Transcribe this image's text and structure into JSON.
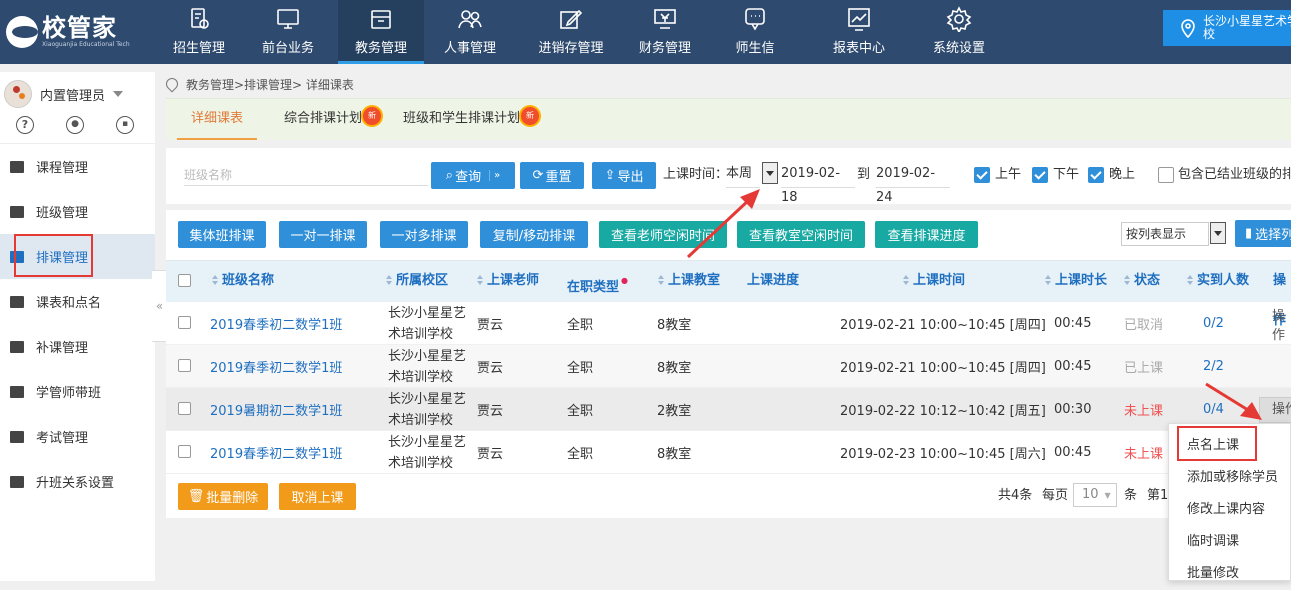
{
  "app": {
    "logo_text": "校管家",
    "logo_sub": "Xiaoguanjia Educational Tech"
  },
  "nav": [
    {
      "label": "招生管理",
      "icon": "enroll-icon"
    },
    {
      "label": "前台业务",
      "icon": "monitor-icon"
    },
    {
      "label": "教务管理",
      "icon": "folder-icon"
    },
    {
      "label": "人事管理",
      "icon": "people-icon"
    },
    {
      "label": "进销存管理",
      "icon": "edit-icon"
    },
    {
      "label": "财务管理",
      "icon": "finance-icon"
    },
    {
      "label": "师生信",
      "icon": "chat-icon"
    },
    {
      "label": "报表中心",
      "icon": "chart-icon"
    },
    {
      "label": "系统设置",
      "icon": "gear-icon"
    }
  ],
  "school": {
    "name": "长沙小星星艺术学校"
  },
  "user": {
    "name": "内置管理员",
    "icons": [
      "?",
      "🔔",
      "💬"
    ]
  },
  "sidebar": [
    {
      "label": "课程管理"
    },
    {
      "label": "班级管理"
    },
    {
      "label": "排课管理"
    },
    {
      "label": "课表和点名"
    },
    {
      "label": "补课管理"
    },
    {
      "label": "学管师带班"
    },
    {
      "label": "考试管理"
    },
    {
      "label": "升班关系设置"
    }
  ],
  "collapse_glyph": "«",
  "breadcrumb": "教务管理>排课管理> 详细课表",
  "tabs": [
    {
      "label": "详细课表"
    },
    {
      "label": "综合排课计划",
      "badge": "新"
    },
    {
      "label": "班级和学生排课计划",
      "badge": "新"
    }
  ],
  "filter": {
    "class_placeholder": "班级名称",
    "query": "查询",
    "reset": "重置",
    "export": "导出",
    "time_label": "上课时间：",
    "period": "本周",
    "date_from": "2019-02-18",
    "to": "到",
    "date_to": "2019-02-24",
    "am": "上午",
    "pm": "下午",
    "eve": "晚上",
    "graduated": "包含已结业班级的排"
  },
  "actions": [
    "集体班排课",
    "一对一排课",
    "一对多排课",
    "复制/移动排课",
    "查看老师空闲时间",
    "查看教室空闲时间",
    "查看排课进度"
  ],
  "display_mode": "按列表显示",
  "select_btn": "选择列",
  "table": {
    "headers": [
      "班级名称",
      "所属校区",
      "上课老师",
      "在职类型",
      "上课教室",
      "上课进度",
      "上课时间",
      "上课时长",
      "状态",
      "实到人数",
      "操作"
    ],
    "rows": [
      {
        "class": "2019春季初二数学1班",
        "campus": "长沙小星星艺术培训学校",
        "teacher": "贾云",
        "type": "全职",
        "room": "8教室",
        "time": "2019-02-21 10:00~10:45 [周四]",
        "dur": "00:45",
        "status": "已取消",
        "count": "0/2",
        "op": "操作"
      },
      {
        "class": "2019春季初二数学1班",
        "campus": "长沙小星星艺术培训学校",
        "teacher": "贾云",
        "type": "全职",
        "room": "8教室",
        "time": "2019-02-21 10:00~10:45 [周四]",
        "dur": "00:45",
        "status": "已上课",
        "count": "2/2",
        "op": ""
      },
      {
        "class": "2019暑期初二数学1班",
        "campus": "长沙小星星艺术培训学校",
        "teacher": "贾云",
        "type": "全职",
        "room": "2教室",
        "time": "2019-02-22 10:12~10:42 [周五]",
        "dur": "00:30",
        "status": "未上课",
        "count": "0/4",
        "op": "操作"
      },
      {
        "class": "2019春季初二数学1班",
        "campus": "长沙小星星艺术培训学校",
        "teacher": "贾云",
        "type": "全职",
        "room": "8教室",
        "time": "2019-02-23 10:00~10:45 [周六]",
        "dur": "00:45",
        "status": "未上课",
        "count": "",
        "op": ""
      }
    ]
  },
  "footer": {
    "batch_delete": "批量删除",
    "cancel_class": "取消上课",
    "total": "共4条",
    "per_page": "每页",
    "per_value": "10",
    "unit": "条",
    "page": "第1"
  },
  "context_menu": [
    "点名上课",
    "添加或移除学员",
    "修改上课内容",
    "临时调课",
    "批量修改"
  ]
}
